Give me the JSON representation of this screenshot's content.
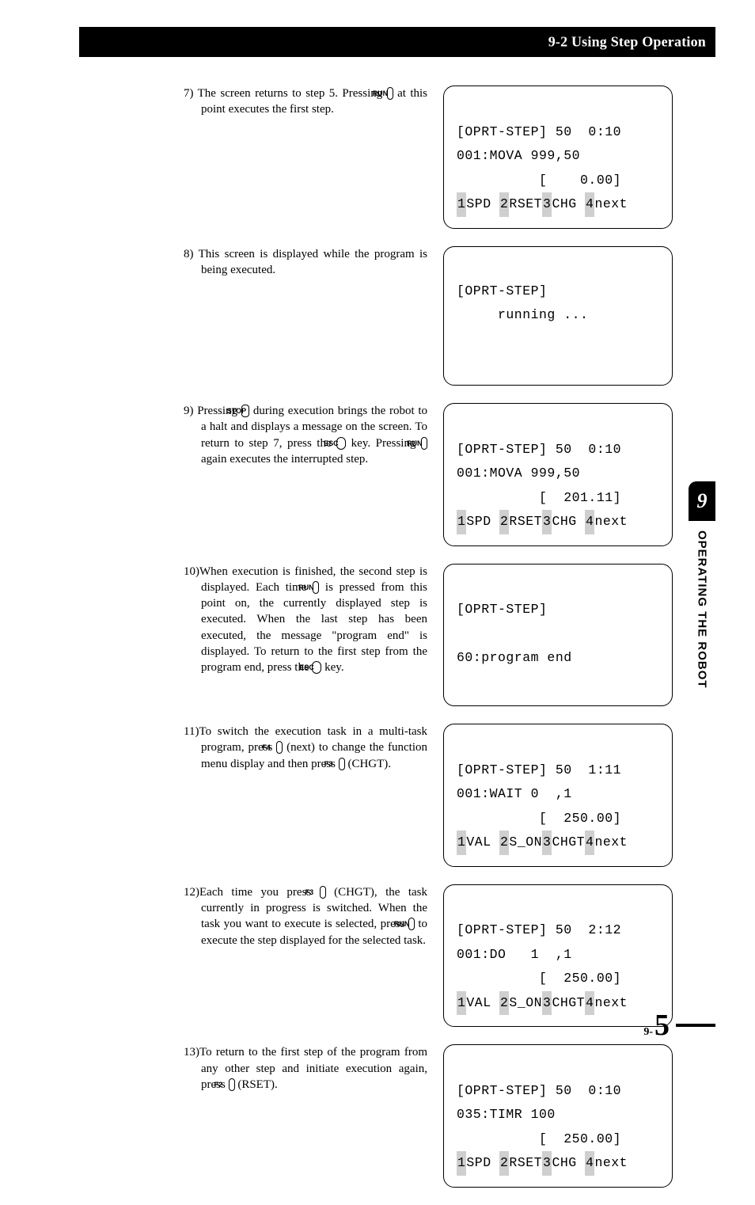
{
  "header": {
    "title": "9-2 Using Step Operation"
  },
  "keys": {
    "run": "RUN",
    "esc": "ESC",
    "stop": "STOP",
    "f2": "F2",
    "f3": "F3",
    "f4": "F4"
  },
  "steps": [
    {
      "num": "7)",
      "pre": "The screen returns to step 5. Pressing ",
      "key": "run",
      "post": " at this point executes the first step."
    },
    {
      "num": "8)",
      "text": "This screen is displayed while the program is being executed."
    },
    {
      "num": "9)",
      "parts": [
        {
          "t": "Pressing "
        },
        {
          "k": "stop"
        },
        {
          "t": " during execution brings the robot to a halt and displays a message on the screen. To return to step 7, press the "
        },
        {
          "k": "esc",
          "oval": true
        },
        {
          "t": " key. Pressing "
        },
        {
          "k": "run"
        },
        {
          "t": " again executes the interrupted step."
        }
      ]
    },
    {
      "num": "10)",
      "parts": [
        {
          "t": "When execution is finished, the second step is displayed. Each time "
        },
        {
          "k": "run"
        },
        {
          "t": " is pressed from this point on, the currently displayed step is executed. When the last step has been executed, the message \"program end\" is displayed. To return to the first step from the program end, press the "
        },
        {
          "k": "esc",
          "oval": true
        },
        {
          "t": " key."
        }
      ]
    },
    {
      "num": "11)",
      "parts": [
        {
          "t": "To switch the execution task in a multi-task program, press "
        },
        {
          "k": "f4"
        },
        {
          "t": " (next) to change the function menu display and then press "
        },
        {
          "k": "f3"
        },
        {
          "t": " (CHGT)."
        }
      ]
    },
    {
      "num": "12)",
      "parts": [
        {
          "t": "Each time you press "
        },
        {
          "k": "f3"
        },
        {
          "t": " (CHGT), the task currently in progress is switched. When the task you want to execute is selected, press "
        },
        {
          "k": "run"
        },
        {
          "t": " to execute the step displayed for the selected task."
        }
      ]
    },
    {
      "num": "13)",
      "parts": [
        {
          "t": "To return to the first step of the program from any other step and initiate execution again, press "
        },
        {
          "k": "f2"
        },
        {
          "t": " (RSET)."
        }
      ]
    }
  ],
  "displays": [
    {
      "l1": "[OPRT-STEP] 50  0:10",
      "l2": "001:MOVA 999,50",
      "l3": "          [    0.00]",
      "sk": [
        {
          "n": "1",
          "t": "SPD "
        },
        {
          "n": "2",
          "t": "RSET"
        },
        {
          "n": "3",
          "t": "CHG "
        },
        {
          "n": "4",
          "t": "next"
        }
      ]
    },
    {
      "l1": "[OPRT-STEP]",
      "l2": "     running ...",
      "blank": 2
    },
    {
      "l1": "[OPRT-STEP] 50  0:10",
      "l2": "001:MOVA 999,50",
      "l3": "          [  201.11]",
      "sk": [
        {
          "n": "1",
          "t": "SPD "
        },
        {
          "n": "2",
          "t": "RSET"
        },
        {
          "n": "3",
          "t": "CHG "
        },
        {
          "n": "4",
          "t": "next"
        }
      ]
    },
    {
      "l1": "[OPRT-STEP]",
      "gap": true,
      "l2": "60:program end",
      "blank": 1
    },
    {
      "l1": "[OPRT-STEP] 50  1:11",
      "l2": "001:WAIT 0  ,1",
      "l3": "          [  250.00]",
      "sk": [
        {
          "n": "1",
          "t": "VAL "
        },
        {
          "n": "2",
          "t": "S_ON"
        },
        {
          "n": "3",
          "t": "CHGT"
        },
        {
          "n": "4",
          "t": "next"
        }
      ]
    },
    {
      "l1": "[OPRT-STEP] 50  2:12",
      "l2": "001:DO   1  ,1",
      "l3": "          [  250.00]",
      "sk": [
        {
          "n": "1",
          "t": "VAL "
        },
        {
          "n": "2",
          "t": "S_ON"
        },
        {
          "n": "3",
          "t": "CHGT"
        },
        {
          "n": "4",
          "t": "next"
        }
      ]
    },
    {
      "l1": "[OPRT-STEP] 50  0:10",
      "l2": "035:TIMR 100",
      "l3": "          [  250.00]",
      "sk": [
        {
          "n": "1",
          "t": "SPD "
        },
        {
          "n": "2",
          "t": "RSET"
        },
        {
          "n": "3",
          "t": "CHG "
        },
        {
          "n": "4",
          "t": "next"
        }
      ]
    }
  ],
  "sidebar": {
    "chapter_num": "9",
    "chapter_title": "OPERATING THE ROBOT"
  },
  "footer": {
    "chapter": "9-",
    "page": "5"
  }
}
